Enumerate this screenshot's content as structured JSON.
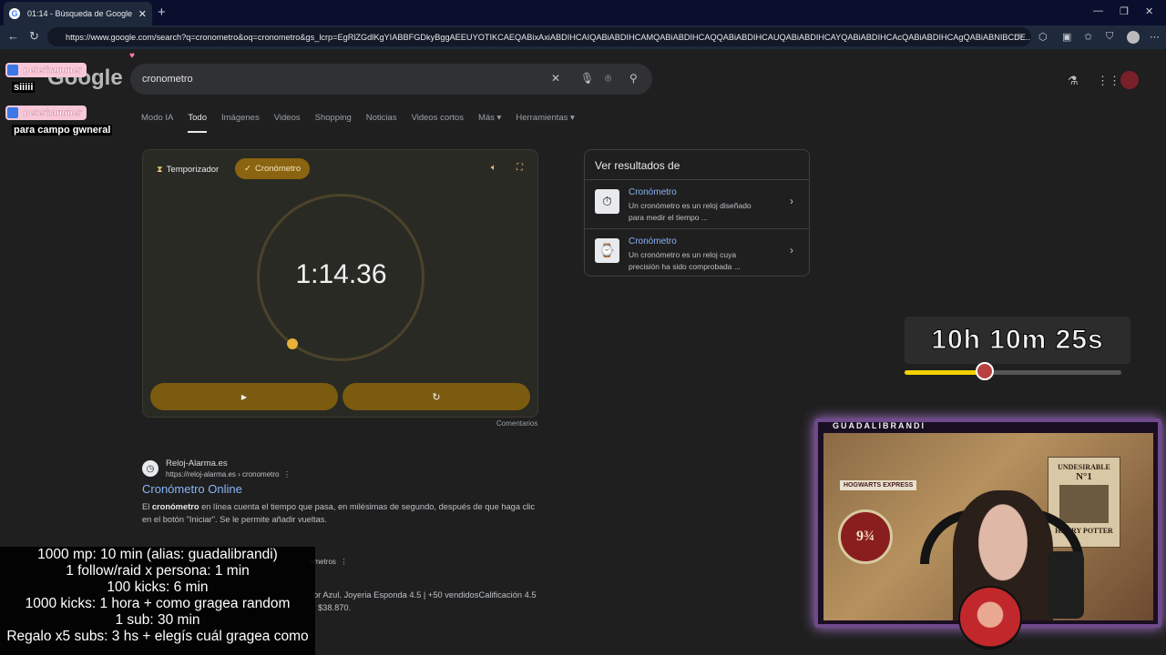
{
  "browser": {
    "tab_title": "01:14 - Búsqueda de Google",
    "tab_favicon": "G",
    "close_tab": "✕",
    "new_tab": "+",
    "url": "https://www.google.com/search?q=cronometro&oq=cronometro&gs_lcrp=EgRlZGdlKgYIABBFGDkyBggAEEUYOTIKCAEQABixAxiABDIHCAIQABiABDIHCAMQABiABDIHCAQQABiABDIHCAUQABiABDIHCAYQABiABDIHCAcQABiABDIHCAgQABiABNIBCDE..."
  },
  "search": {
    "logo": "Google",
    "query": "cronometro",
    "tabs": [
      "Modo IA",
      "Todo",
      "Imágenes",
      "Videos",
      "Shopping",
      "Noticias",
      "Videos cortos",
      "Más ▾",
      "Herramientas ▾"
    ]
  },
  "stopwatch": {
    "timer_label": "Temporizador",
    "stopwatch_label": "Cronómetro",
    "time": "1:14.36",
    "play_glyph": "▶",
    "reset_glyph": "↻",
    "comments": "Comentarios"
  },
  "results": [
    {
      "site": "Reloj-Alarma.es",
      "cite": "https://reloj-alarma.es › cronometro",
      "title": "Cronómetro Online",
      "snippet_bold": "cronómetro",
      "snippet_pre": "El ",
      "snippet_post": " en línea cuenta el tiempo que pasa, en milésimas de segundo, después de que haga clic en el botón \"Iniciar\". Se le permite añadir vueltas."
    },
    {
      "cite_fragment": "ometros",
      "snippet": "or Azul. Joyeria Esponda 4.5 | +50 vendidosCalificación 4.5",
      "price": "$38.870."
    }
  ],
  "knowledge_panel": {
    "heading": "Ver resultados de",
    "items": [
      {
        "title": "Cronómetro",
        "desc": "Un cronómetro es un reloj diseñado para medir el tiempo ..."
      },
      {
        "title": "Cronómetro",
        "desc": "Un cronómetro es un reloj cuya precisión ha sido comprobada ..."
      }
    ]
  },
  "overlay": {
    "chat": [
      {
        "user": "peterhammer",
        "msg": "siiiii"
      },
      {
        "user": "peterhammer",
        "msg": "para campo gwneral"
      }
    ],
    "countdown": "10h 10m 25s",
    "progress_fraction": 0.37,
    "cam_label": "GUADALIBRANDI",
    "poster_title": "UNDESIRABLE",
    "poster_no": "N°1",
    "poster_name": "HARRY POTTER",
    "platform": "9¾",
    "sign": "HOGWARTS EXPRESS",
    "goals": [
      "1000 mp: 10 min (alias: guadalibrandi)",
      "1 follow/raid x persona: 1 min",
      "100 kicks: 6 min",
      "1000 kicks: 1 hora + como gragea random",
      "1 sub: 30 min",
      "Regalo x5 subs: 3 hs + elegís cuál gragea como"
    ]
  },
  "colors": {
    "accent_gold": "#8a6410",
    "link_blue": "#8ab4f8",
    "progress_yellow": "#f5d000",
    "cam_border": "#6f4a8c"
  }
}
